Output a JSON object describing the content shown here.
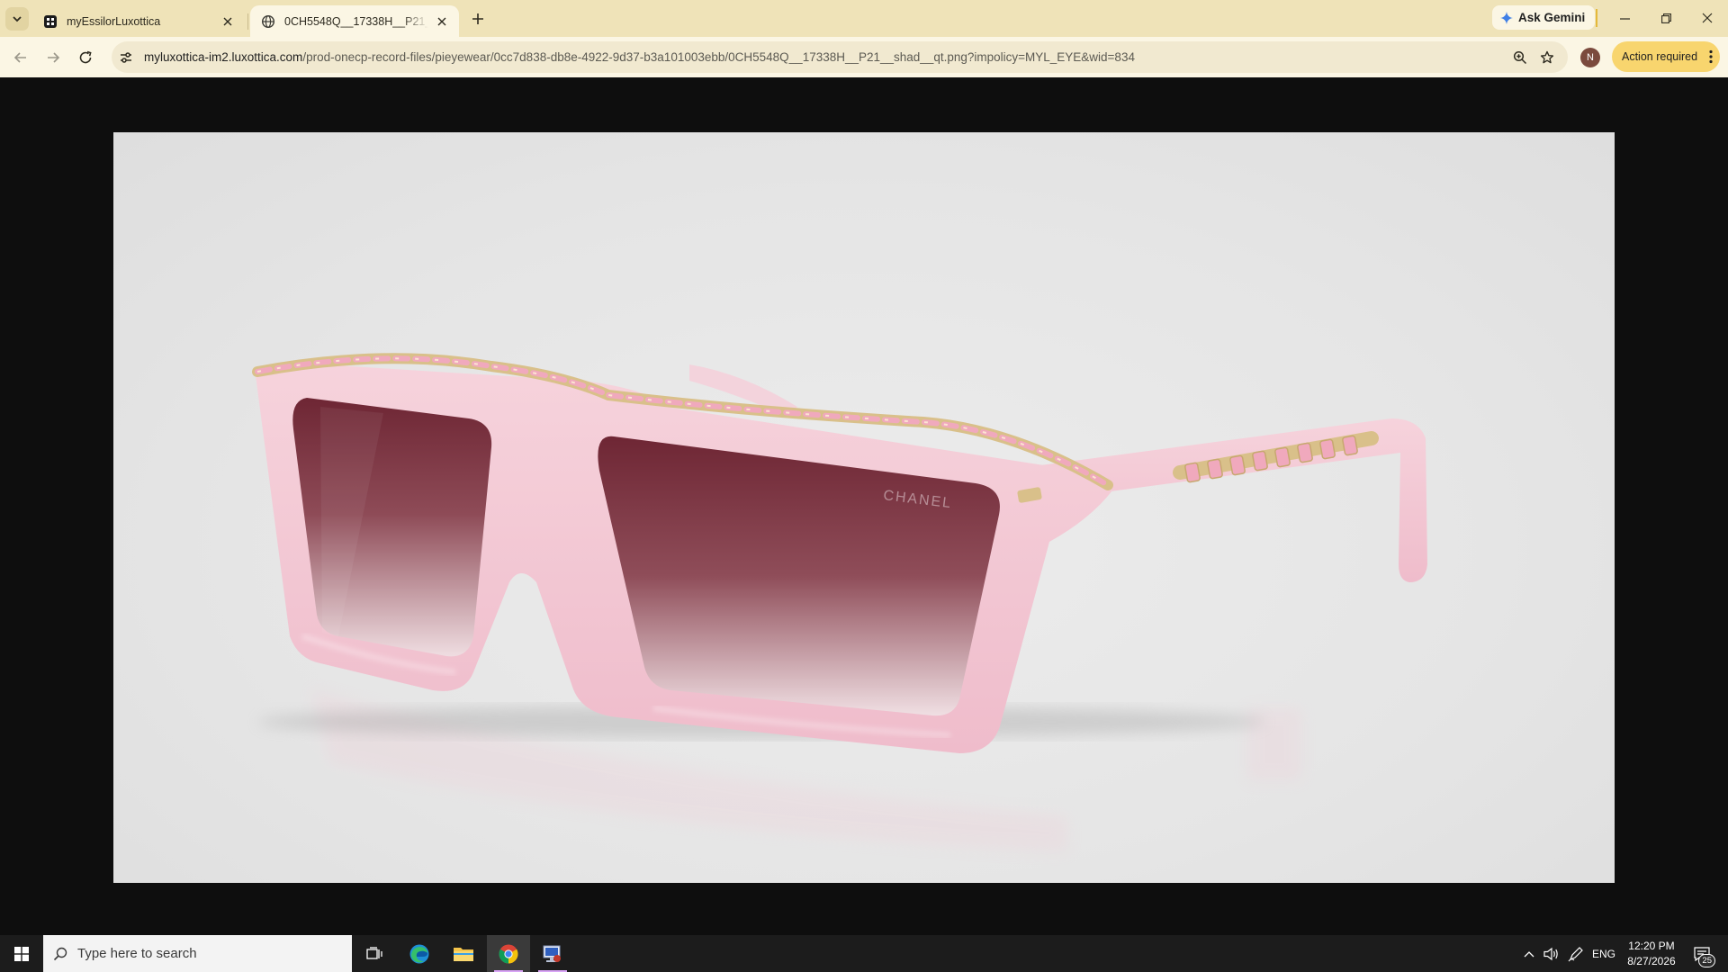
{
  "browser": {
    "tabs": [
      {
        "label": "myEssilorLuxottica",
        "active": false
      },
      {
        "label": "0CH5548Q__17338H__P21__shad__qt.png",
        "active": true
      }
    ],
    "gemini_label": "Ask Gemini",
    "url_host": "myluxottica-im2.luxottica.com",
    "url_path": "/prod-onecp-record-files/pieyewear/0cc7d838-db8e-4922-9d37-b3a101003ebb/0CH5548Q__17338H__P21__shad__qt.png?impolicy=MYL_EYE&wid=834",
    "profile_initial": "N",
    "action_required_label": "Action required"
  },
  "content": {
    "brand_engraving": "CHANEL",
    "frame_color": "#f2c6d3",
    "lens_color_top": "#6e2634",
    "chain_color": "#d9c08a"
  },
  "taskbar": {
    "search_placeholder": "Type here to search",
    "language": "ENG",
    "time": "12:20 PM",
    "date": "8/27/2026",
    "notification_count": "25"
  }
}
